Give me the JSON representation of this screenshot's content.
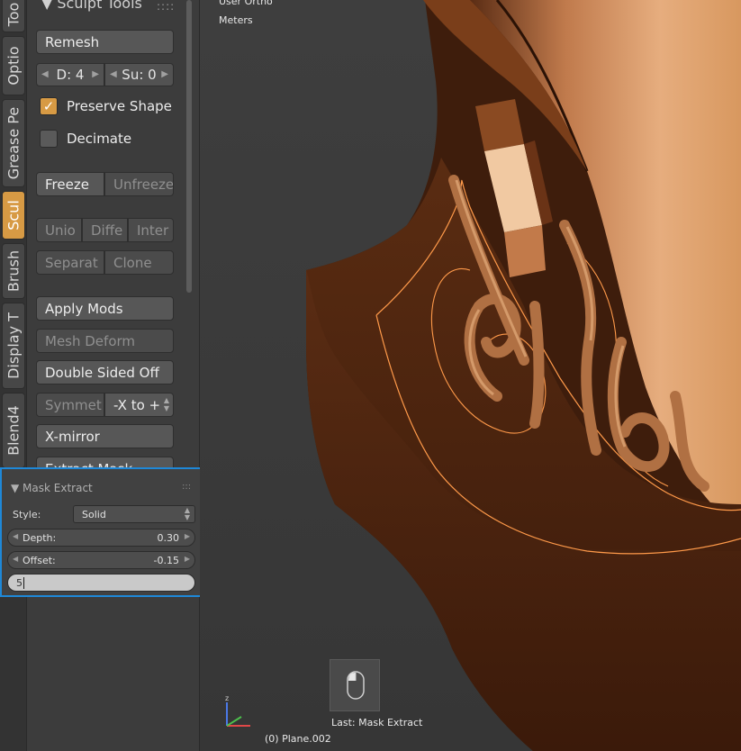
{
  "tabs": [
    {
      "label": "Too",
      "active": false
    },
    {
      "label": "Optio",
      "active": false
    },
    {
      "label": "Grease Pe",
      "active": false
    },
    {
      "label": "Scul",
      "active": true
    },
    {
      "label": "Brush",
      "active": false
    },
    {
      "label": "Display T",
      "active": false
    },
    {
      "label": "Blend4",
      "active": false
    }
  ],
  "panel": {
    "header": "Sculpt Tools",
    "remesh_label": "Remesh",
    "depth_field": "D: 4",
    "subdiv_field": "Su: 0",
    "preserve_shape": {
      "label": "Preserve Shape",
      "checked": true
    },
    "decimate": {
      "label": "Decimate",
      "checked": false
    },
    "freeze_label": "Freeze",
    "unfreeze_label": "Unfreeze",
    "boolean_ops": [
      "Unio",
      "Diffe",
      "Inter"
    ],
    "separate_label": "Separat",
    "clone_label": "Clone",
    "apply_mods_label": "Apply Mods",
    "mesh_deform_label": "Mesh Deform",
    "double_sided_label": "Double Sided Off",
    "symmetry_label": "Symmet",
    "symmetry_value": "-X to +",
    "x_mirror_label": "X-mirror",
    "extract_mask_label": "Extract Mask"
  },
  "redo_panel": {
    "title": "Mask Extract",
    "style_label": "Style:",
    "style_value": "Solid",
    "depth_label": "Depth:",
    "depth_value": "0.30",
    "offset_label": "Offset:",
    "offset_value": "-0.15",
    "smooth_input": "5"
  },
  "viewport": {
    "view_name": "User Ortho",
    "units": "Meters",
    "last_operator": "Last: Mask Extract",
    "object_name": "(0) Plane.002"
  },
  "colors": {
    "accent": "#d79a44",
    "selection_outline": "#1e88d8",
    "wood_dark": "#4a2410",
    "wood_light": "#e0a876",
    "mask_outline": "#ff9a4a"
  }
}
